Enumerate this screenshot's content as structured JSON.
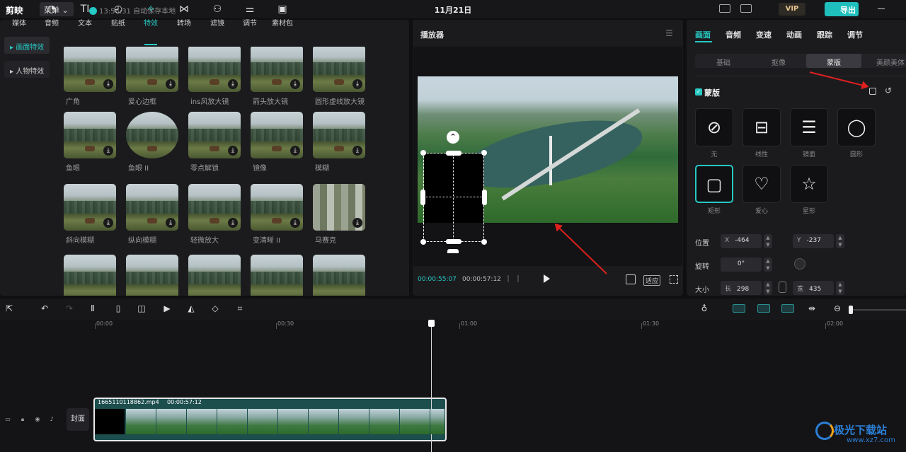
{
  "titlebar": {
    "app_name": "剪映",
    "menu_label": "菜单",
    "save_status": "13:56:31 自动保存本地",
    "doc_title": "11月21日",
    "vip_label": "VIP",
    "export_label": "导出"
  },
  "media": {
    "tabs": [
      {
        "label": "媒体",
        "icon": "media-icon"
      },
      {
        "label": "音频",
        "icon": "audio-icon"
      },
      {
        "label": "文本",
        "icon": "text-icon"
      },
      {
        "label": "贴纸",
        "icon": "sticker-icon"
      },
      {
        "label": "特效",
        "icon": "effects-icon"
      },
      {
        "label": "转场",
        "icon": "transition-icon"
      },
      {
        "label": "滤镜",
        "icon": "filter-icon"
      },
      {
        "label": "调节",
        "icon": "adjust-icon"
      },
      {
        "label": "素材包",
        "icon": "package-icon"
      }
    ],
    "side_categories": [
      "画面特效",
      "人物特效"
    ],
    "effects": [
      [
        "广角",
        "爱心边框",
        "ins风放大镜",
        "箭头放大镜",
        "圆形虚线放大镜"
      ],
      [
        "鱼眼",
        "鱼眼 II",
        "零点解锁",
        "镜像",
        "模糊"
      ],
      [
        "斜向模糊",
        "纵向模糊",
        "轻微放大",
        "变清晰 II",
        "马赛克"
      ]
    ]
  },
  "player": {
    "title": "播放器",
    "time_current": "00:00:55:07",
    "time_total": "00:00:57:12",
    "fit_label": "适应"
  },
  "props": {
    "tabs": [
      "画面",
      "音频",
      "变速",
      "动画",
      "跟踪",
      "调节"
    ],
    "sub_tabs": [
      "基础",
      "抠像",
      "蒙版",
      "美颜美体"
    ],
    "mask_section": "蒙版",
    "mask_options": [
      "无",
      "线性",
      "镜面",
      "圆形",
      "矩形",
      "爱心",
      "星形"
    ],
    "position_label": "位置",
    "pos_x_key": "X",
    "pos_x": "-464",
    "pos_y_key": "Y",
    "pos_y": "-237",
    "rotate_label": "旋转",
    "rotate_value": "0°",
    "size_label": "大小",
    "length_key": "长",
    "length_value": "298",
    "width_key": "宽",
    "width_value": "435"
  },
  "timeline": {
    "ticks": [
      "00:00",
      "00:30",
      "01:00",
      "01:30",
      "02:00"
    ],
    "clip_name": "1665110118862.mp4",
    "clip_duration": "00:00:57:12",
    "cover_label": "封面"
  },
  "watermark": {
    "text": "极光下载站",
    "url": "www.xz7.com"
  },
  "colors": {
    "accent": "#26c9c3",
    "annotation_arrow": "#e0201e"
  }
}
